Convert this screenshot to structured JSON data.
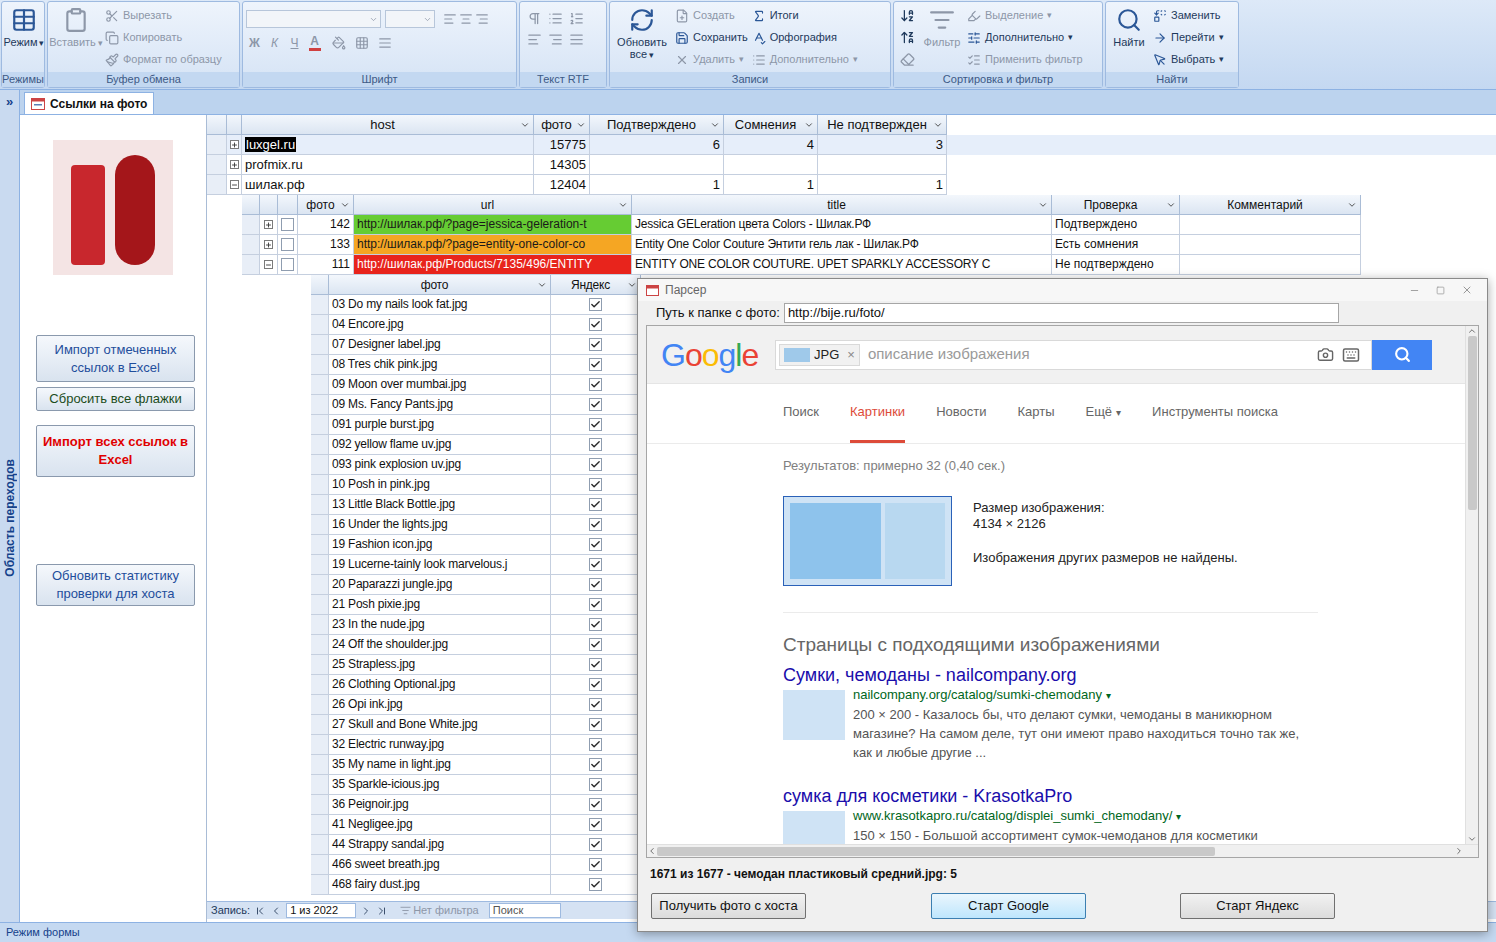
{
  "ribbon": {
    "groups": [
      {
        "label": "Режимы",
        "kind": "buttons",
        "large": [
          {
            "label": "Режим",
            "arrow": "▾",
            "disabled": false
          }
        ],
        "columns": []
      },
      {
        "label": "Буфер обмена",
        "kind": "buttons",
        "large": [
          {
            "label": "Вставить",
            "arrow": "▾",
            "disabled": true
          }
        ],
        "columns": [
          [
            {
              "label": "Вырезать",
              "disabled": true
            },
            {
              "label": "Копировать",
              "disabled": true
            },
            {
              "label": "Формат по образцу",
              "disabled": true
            }
          ]
        ]
      },
      {
        "label": "Шрифт",
        "kind": "font",
        "combos": [
          {
            "disabled": true
          },
          {
            "disabled": true
          }
        ],
        "tools": [
          {
            "label": "Ж",
            "disabled": true
          },
          {
            "label": "К",
            "disabled": true
          },
          {
            "label": "Ч",
            "disabled": true
          },
          {
            "label": "A",
            "disabled": true
          }
        ]
      },
      {
        "label": "Текст RTF",
        "kind": "rtf",
        "disabled": true
      },
      {
        "label": "Записи",
        "kind": "buttons",
        "large": [
          {
            "label": "Обновить все",
            "arrow": "▾",
            "disabled": false
          }
        ],
        "columns": [
          [
            {
              "label": "Создать",
              "disabled": true
            },
            {
              "label": "Сохранить",
              "disabled": false
            },
            {
              "label": "Удалить",
              "arrow": "▾",
              "disabled": true
            }
          ],
          [
            {
              "label": "Итоги",
              "disabled": false
            },
            {
              "label": "Орфография",
              "disabled": false
            },
            {
              "label": "Дополнительно",
              "arrow": "▾",
              "disabled": true
            }
          ]
        ]
      },
      {
        "label": "Сортировка и фильтр",
        "kind": "buttons",
        "icon_tools": [
          {
            "disabled": false
          },
          {
            "disabled": false
          },
          {
            "disabled": true
          }
        ],
        "large": [
          {
            "label": "Фильтр",
            "disabled": true
          }
        ],
        "columns": [
          [
            {
              "label": "Выделение",
              "arrow": "▾",
              "disabled": true
            },
            {
              "label": "Дополнительно",
              "arrow": "▾",
              "disabled": false
            },
            {
              "label": "Применить фильтр",
              "disabled": true
            }
          ]
        ]
      },
      {
        "label": "Найти",
        "kind": "buttons",
        "large": [
          {
            "label": "Найти",
            "disabled": false
          }
        ],
        "columns": [
          [
            {
              "label": "Заменить",
              "disabled": false
            },
            {
              "label": "Перейти",
              "arrow": "▾",
              "disabled": false
            },
            {
              "label": "Выбрать",
              "arrow": "▾",
              "disabled": false
            }
          ]
        ]
      }
    ]
  },
  "nav_pane": {
    "toggle": "»",
    "label": "Область переходов",
    "expanded": false
  },
  "document_tab": {
    "label": "Ссылки на фото",
    "selected": true
  },
  "form": {
    "buttons": [
      {
        "label": "Импорт отмеченных ссылок в Excel",
        "color": "#1f4e9c",
        "bold": false
      },
      {
        "label": "Сбросить все флажки",
        "color": "#1c4d1c",
        "bold": false
      },
      {
        "label": "Импорт всех ссылок в Excel",
        "color": "#e00000",
        "bold": true
      },
      {
        "label": "Обновить статистику проверки для хоста",
        "color": "#1f4e9c",
        "bold": false
      }
    ]
  },
  "datasheet": {
    "columns": [
      "host",
      "фото",
      "Подтверждено",
      "Сомнения",
      "Не подтвержден"
    ],
    "rows": [
      {
        "cells": [
          "luxgel.ru",
          "15775",
          "6",
          "4",
          "3"
        ],
        "selected": true,
        "expanded": false
      },
      {
        "cells": [
          "profmix.ru",
          "14305",
          "",
          "",
          ""
        ],
        "selected": false,
        "expanded": false
      },
      {
        "cells": [
          "шилак.рф",
          "12404",
          "1",
          "1",
          "1"
        ],
        "selected": false,
        "expanded": true,
        "sub": {
          "columns": [
            "фото",
            "url",
            "title",
            "Проверка",
            "Комментарий"
          ],
          "rows": [
            {
              "checked": false,
              "expanded": false,
              "foto": "142",
              "url": "http://шилак.рф/?page=jessica-geleration-t",
              "color": "#66cc33",
              "text_color": "#1a1a1a",
              "title": "Jessica GELeration цвета Colors - Шилак.РФ",
              "check": "Подтверждено",
              "comment": ""
            },
            {
              "checked": false,
              "expanded": false,
              "foto": "133",
              "url": "http://шилак.рф/?page=entity-one-color-co",
              "color": "#f5a623",
              "text_color": "#1a1a1a",
              "title": "Entity One Color Couture Энтити гель лак - Шилак.РФ",
              "check": "Есть сомнения",
              "comment": ""
            },
            {
              "checked": false,
              "expanded": true,
              "foto": "111",
              "url": "http://шилак.рф/Products/7135/496/ENTITY",
              "color": "#e8241c",
              "text_color": "#ffffff",
              "title": "ENTITY ONE COLOR COUTURE. UPET SPARKLY ACCESSORY C",
              "check": "Не подтверждено",
              "comment": "",
              "sub": {
                "columns": [
                  "фото",
                  "Яндекс"
                ],
                "rows": [
                  {
                    "file": "03 Do my nails look fat.jpg",
                    "yandex": true
                  },
                  {
                    "file": "04 Encore.jpg",
                    "yandex": true
                  },
                  {
                    "file": "07 Designer label.jpg",
                    "yandex": true
                  },
                  {
                    "file": "08 Tres chik pink.jpg",
                    "yandex": true
                  },
                  {
                    "file": "09 Moon over mumbai.jpg",
                    "yandex": true
                  },
                  {
                    "file": "09 Ms. Fancy Pants.jpg",
                    "yandex": true
                  },
                  {
                    "file": "091 purple burst.jpg",
                    "yandex": true
                  },
                  {
                    "file": "092 yellow flame uv.jpg",
                    "yandex": true
                  },
                  {
                    "file": "093 pink explosion uv.jpg",
                    "yandex": true
                  },
                  {
                    "file": "10 Posh in pink.jpg",
                    "yandex": true
                  },
                  {
                    "file": "13 Little Black Bottle.jpg",
                    "yandex": true
                  },
                  {
                    "file": "16 Under the lights.jpg",
                    "yandex": true
                  },
                  {
                    "file": "19 Fashion icon.jpg",
                    "yandex": true
                  },
                  {
                    "file": "19 Lucerne-tainly look marvelous.j",
                    "yandex": true
                  },
                  {
                    "file": "20 Paparazzi jungle.jpg",
                    "yandex": true
                  },
                  {
                    "file": "21 Posh pixie.jpg",
                    "yandex": true
                  },
                  {
                    "file": "23 In the nude.jpg",
                    "yandex": true
                  },
                  {
                    "file": "24 Off the shoulder.jpg",
                    "yandex": true
                  },
                  {
                    "file": "25 Strapless.jpg",
                    "yandex": true
                  },
                  {
                    "file": "26 Clothing Optional.jpg",
                    "yandex": true
                  },
                  {
                    "file": "26 Opi ink.jpg",
                    "yandex": true
                  },
                  {
                    "file": "27 Skull and Bone White.jpg",
                    "yandex": true
                  },
                  {
                    "file": "32 Electric runway.jpg",
                    "yandex": true
                  },
                  {
                    "file": "35 My name in light.jpg",
                    "yandex": true
                  },
                  {
                    "file": "35 Sparkle-icious.jpg",
                    "yandex": true
                  },
                  {
                    "file": "36 Peignoir.jpg",
                    "yandex": true
                  },
                  {
                    "file": "41 Negligee.jpg",
                    "yandex": true
                  },
                  {
                    "file": "44 Strappy sandal.jpg",
                    "yandex": true
                  },
                  {
                    "file": "466 sweet breath.jpg",
                    "yandex": true
                  },
                  {
                    "file": "468 fairy dust.jpg",
                    "yandex": true
                  }
                ]
              }
            }
          ]
        }
      }
    ]
  },
  "record_nav": {
    "label": "Запись:",
    "position": "1 из 2022",
    "filter": "Нет фильтра",
    "filtered": false,
    "search_placeholder": "Поиск"
  },
  "status_bar": {
    "text": "Режим формы"
  },
  "parser": {
    "title": "Парсер",
    "path_label": "Путь к папке с фото:",
    "path_value": "http://bije.ru/foto/",
    "browser": {
      "logo": [
        {
          "char": "G",
          "color": "#4285f4"
        },
        {
          "char": "o",
          "color": "#ea4335"
        },
        {
          "char": "o",
          "color": "#fbbc05"
        },
        {
          "char": "g",
          "color": "#4285f4"
        },
        {
          "char": "l",
          "color": "#34a853"
        },
        {
          "char": "e",
          "color": "#ea4335"
        }
      ],
      "chip": "JPG",
      "chip_close": "×",
      "placeholder": "описание изображения",
      "tabs": [
        {
          "label": "Поиск",
          "selected": false
        },
        {
          "label": "Картинки",
          "selected": true
        },
        {
          "label": "Новости",
          "selected": false
        },
        {
          "label": "Карты",
          "selected": false
        },
        {
          "label": "Ещё",
          "arrow": "▾",
          "selected": false
        },
        {
          "label": "Инструменты поиска",
          "selected": false
        }
      ],
      "stats": "Результатов: примерно 32 (0,40 сек.)",
      "size_label": "Размер изображения:",
      "size": "4134 × 2126",
      "no_other": "Изображения других размеров не найдены.",
      "heading": "Страницы с подходящими изображениями",
      "results": [
        {
          "title": "Сумки, чемоданы - nailcompany.org",
          "url": "nailcompany.org/catalog/sumki-chemodany",
          "arrow": "▾",
          "desc": "200 × 200 - Казалось бы, что делают сумки, чемоданы в маникюрном магазине? На самом деле, тут они имеют право находиться точно так же, как и любые другие ..."
        },
        {
          "title": "сумка для косметики - KrasotkaPro",
          "url": "www.krasotkapro.ru/catalog/displei_sumki_chemodany/",
          "arrow": "▾",
          "desc": "150 × 150 - Большой ассортимент сумок-чемоданов для косметики"
        }
      ],
      "vscroll_level": 0.35,
      "hscroll_level": 0.7
    },
    "status": "1671 из 1677 - чемодан пластиковый средний.jpg: 5",
    "buttons": [
      {
        "label": "Получить фото с хоста",
        "default": false
      },
      {
        "label": "Старт Google",
        "default": true
      },
      {
        "label": "Старт Яндекс",
        "default": false
      }
    ]
  }
}
